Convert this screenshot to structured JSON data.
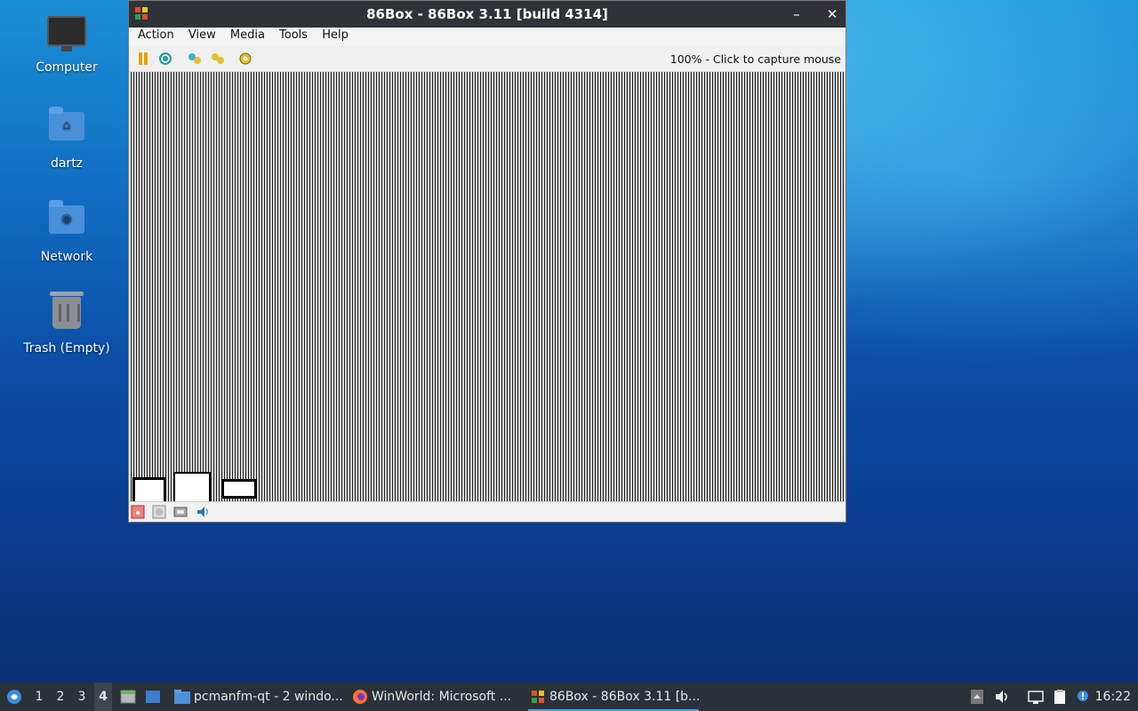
{
  "desktop": {
    "icons": [
      {
        "label": "Computer"
      },
      {
        "label": "dartz"
      },
      {
        "label": "Network"
      },
      {
        "label": "Trash (Empty)"
      }
    ]
  },
  "window": {
    "title": "86Box - 86Box 3.11 [build 4314]",
    "minimize": "–",
    "close": "✕",
    "menu": [
      "Action",
      "View",
      "Media",
      "Tools",
      "Help"
    ],
    "status_text": "100% - Click to capture mouse"
  },
  "taskbar": {
    "workspaces": [
      "1",
      "2",
      "3",
      "4"
    ],
    "active_workspace": "4",
    "tasks": [
      {
        "label": "pcmanfm-qt - 2 windo..."
      },
      {
        "label": "WinWorld: Microsoft ..."
      },
      {
        "label": "86Box - 86Box 3.11 [b..."
      }
    ],
    "clock": "16:22"
  },
  "colors": {
    "titlebar": "#2f3337",
    "taskbar": "#2b3138",
    "accent": "#4aa3df"
  }
}
